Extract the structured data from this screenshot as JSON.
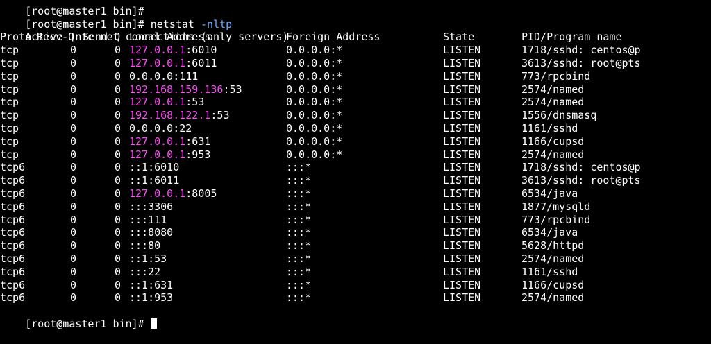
{
  "terminal": {
    "prev_prompt": "[root@master1 bin]#",
    "prompt": "[root@master1 bin]# ",
    "command": "netstat",
    "option": "-nltp",
    "title_line": "Active Internet connections (only servers)",
    "last_prompt": "[root@master1 bin]# "
  },
  "table": {
    "headers": {
      "proto": "Proto",
      "recvq": "Recv-Q",
      "sendq": "Send-Q",
      "local": "Local Address",
      "foreign": "Foreign Address",
      "state": "State",
      "pid": "PID/Program name"
    },
    "rows": [
      {
        "proto": "tcp",
        "recvq": "0",
        "sendq": "0",
        "local_host": "127.0.0.1",
        "local_port": ":6010",
        "foreign": "0.0.0.0:*",
        "state": "LISTEN",
        "pid": "1718/sshd: centos@p"
      },
      {
        "proto": "tcp",
        "recvq": "0",
        "sendq": "0",
        "local_host": "127.0.0.1",
        "local_port": ":6011",
        "foreign": "0.0.0.0:*",
        "state": "LISTEN",
        "pid": "3613/sshd: root@pts"
      },
      {
        "proto": "tcp",
        "recvq": "0",
        "sendq": "0",
        "local_host": "",
        "local_port": "0.0.0.0:111",
        "foreign": "0.0.0.0:*",
        "state": "LISTEN",
        "pid": "773/rpcbind"
      },
      {
        "proto": "tcp",
        "recvq": "0",
        "sendq": "0",
        "local_host": "192.168.159.136",
        "local_port": ":53",
        "foreign": "0.0.0.0:*",
        "state": "LISTEN",
        "pid": "2574/named"
      },
      {
        "proto": "tcp",
        "recvq": "0",
        "sendq": "0",
        "local_host": "127.0.0.1",
        "local_port": ":53",
        "foreign": "0.0.0.0:*",
        "state": "LISTEN",
        "pid": "2574/named"
      },
      {
        "proto": "tcp",
        "recvq": "0",
        "sendq": "0",
        "local_host": "192.168.122.1",
        "local_port": ":53",
        "foreign": "0.0.0.0:*",
        "state": "LISTEN",
        "pid": "1556/dnsmasq"
      },
      {
        "proto": "tcp",
        "recvq": "0",
        "sendq": "0",
        "local_host": "",
        "local_port": "0.0.0.0:22",
        "foreign": "0.0.0.0:*",
        "state": "LISTEN",
        "pid": "1161/sshd"
      },
      {
        "proto": "tcp",
        "recvq": "0",
        "sendq": "0",
        "local_host": "127.0.0.1",
        "local_port": ":631",
        "foreign": "0.0.0.0:*",
        "state": "LISTEN",
        "pid": "1166/cupsd"
      },
      {
        "proto": "tcp",
        "recvq": "0",
        "sendq": "0",
        "local_host": "127.0.0.1",
        "local_port": ":953",
        "foreign": "0.0.0.0:*",
        "state": "LISTEN",
        "pid": "2574/named"
      },
      {
        "proto": "tcp6",
        "recvq": "0",
        "sendq": "0",
        "local_host": "",
        "local_port": "::1:6010",
        "foreign": ":::*",
        "state": "LISTEN",
        "pid": "1718/sshd: centos@p"
      },
      {
        "proto": "tcp6",
        "recvq": "0",
        "sendq": "0",
        "local_host": "",
        "local_port": "::1:6011",
        "foreign": ":::*",
        "state": "LISTEN",
        "pid": "3613/sshd: root@pts"
      },
      {
        "proto": "tcp6",
        "recvq": "0",
        "sendq": "0",
        "local_host": "127.0.0.1",
        "local_port": ":8005",
        "foreign": ":::*",
        "state": "LISTEN",
        "pid": "6534/java"
      },
      {
        "proto": "tcp6",
        "recvq": "0",
        "sendq": "0",
        "local_host": "",
        "local_port": ":::3306",
        "foreign": ":::*",
        "state": "LISTEN",
        "pid": "1877/mysqld"
      },
      {
        "proto": "tcp6",
        "recvq": "0",
        "sendq": "0",
        "local_host": "",
        "local_port": ":::111",
        "foreign": ":::*",
        "state": "LISTEN",
        "pid": "773/rpcbind"
      },
      {
        "proto": "tcp6",
        "recvq": "0",
        "sendq": "0",
        "local_host": "",
        "local_port": ":::8080",
        "foreign": ":::*",
        "state": "LISTEN",
        "pid": "6534/java"
      },
      {
        "proto": "tcp6",
        "recvq": "0",
        "sendq": "0",
        "local_host": "",
        "local_port": ":::80",
        "foreign": ":::*",
        "state": "LISTEN",
        "pid": "5628/httpd"
      },
      {
        "proto": "tcp6",
        "recvq": "0",
        "sendq": "0",
        "local_host": "",
        "local_port": "::1:53",
        "foreign": ":::*",
        "state": "LISTEN",
        "pid": "2574/named"
      },
      {
        "proto": "tcp6",
        "recvq": "0",
        "sendq": "0",
        "local_host": "",
        "local_port": ":::22",
        "foreign": ":::*",
        "state": "LISTEN",
        "pid": "1161/sshd"
      },
      {
        "proto": "tcp6",
        "recvq": "0",
        "sendq": "0",
        "local_host": "",
        "local_port": "::1:631",
        "foreign": ":::*",
        "state": "LISTEN",
        "pid": "1166/cupsd"
      },
      {
        "proto": "tcp6",
        "recvq": "0",
        "sendq": "0",
        "local_host": "",
        "local_port": "::1:953",
        "foreign": ":::*",
        "state": "LISTEN",
        "pid": "2574/named"
      }
    ]
  },
  "colors": {
    "background": "#000000",
    "text": "#ffffff",
    "highlight_host": "#ff4af7",
    "option": "#6fa8ff"
  },
  "icons": {
    "cursor": "cursor-block-icon"
  }
}
